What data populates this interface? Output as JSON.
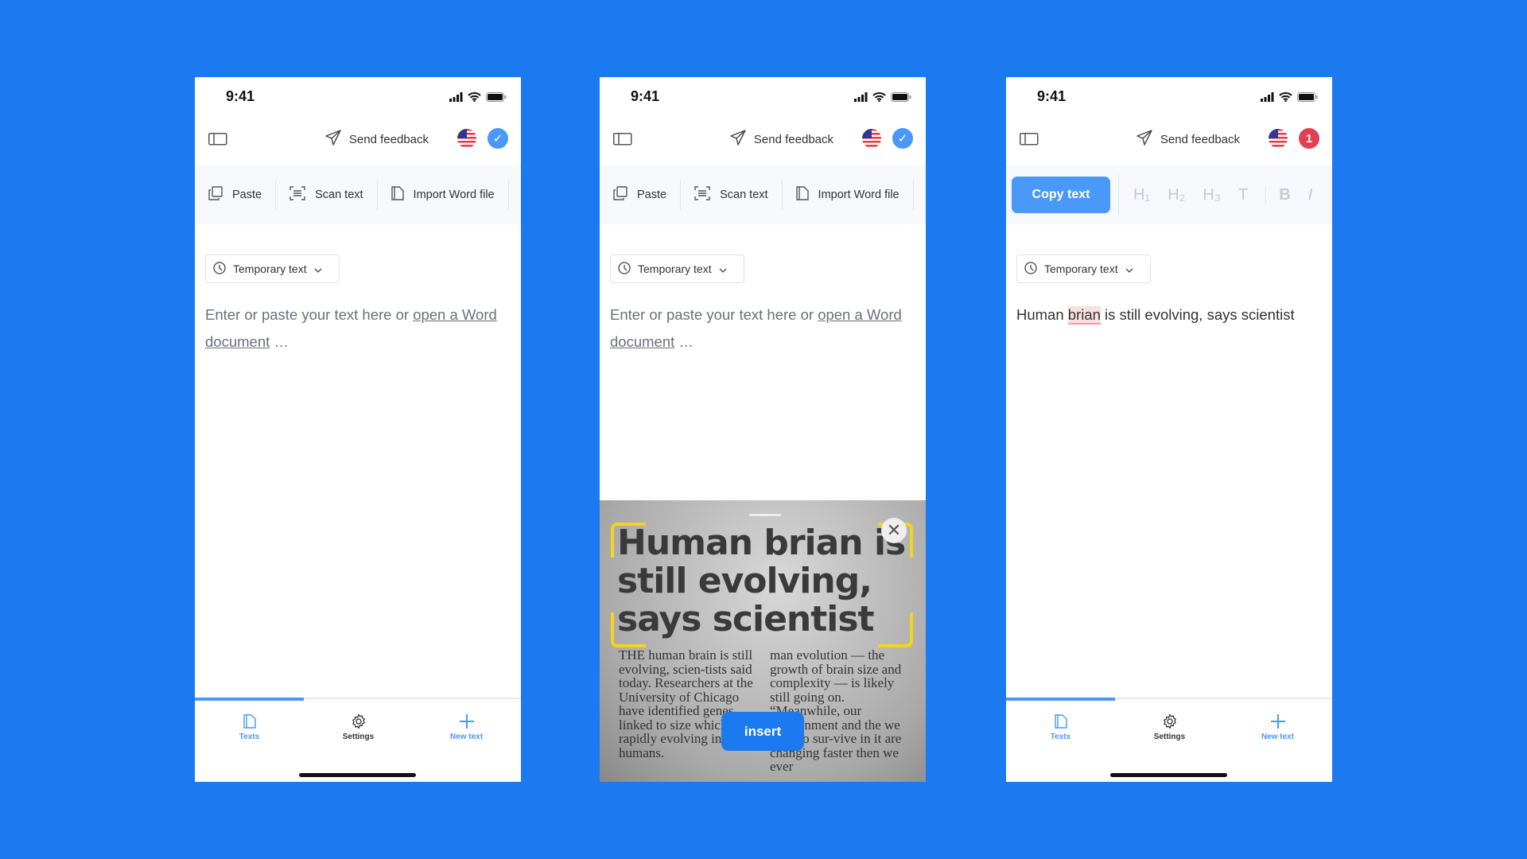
{
  "accent": "#4a98f7",
  "background": "#1b7af0",
  "screens": [
    {
      "status_time": "9:41",
      "send_feedback": "Send feedback",
      "badge": {
        "type": "check",
        "text": "✓",
        "color": "#4a98f7"
      },
      "toolbar": {
        "paste": "Paste",
        "scan": "Scan text",
        "import": "Import Word file"
      },
      "dropdown": "Temporary text",
      "placeholder": {
        "before": "Enter or paste your text here or ",
        "link": "open a Word document",
        "after": " …"
      },
      "nav": {
        "texts": "Texts",
        "settings": "Settings",
        "new_text": "New text"
      }
    },
    {
      "status_time": "9:41",
      "send_feedback": "Send feedback",
      "badge": {
        "type": "check",
        "text": "✓",
        "color": "#4a98f7"
      },
      "toolbar": {
        "paste": "Paste",
        "scan": "Scan text",
        "import": "Import Word file"
      },
      "dropdown": "Temporary text",
      "placeholder": {
        "before": "Enter or paste your text here or ",
        "link": "open a Word document",
        "after": " …"
      },
      "scanner": {
        "headline": [
          "Human brian is",
          "still evolving,",
          "says scientist"
        ],
        "column1": "THE human brain is still evolving, scien-tists said today. Researchers at the University of Chicago have identified genes linked to size which are rapidly evolving in humans.",
        "column2": "man evolution — the growth of brain size and complexity — is likely still going on. “Meanwhile, our environment and the we need to sur-vive in it are changing faster then we ever",
        "insert": "insert"
      }
    },
    {
      "status_time": "9:41",
      "send_feedback": "Send feedback",
      "badge": {
        "type": "count",
        "text": "1",
        "color": "#e0404f"
      },
      "copy_text": "Copy text",
      "format": [
        "H₁",
        "H₂",
        "H₃",
        "T",
        "B",
        "I"
      ],
      "dropdown": "Temporary text",
      "content": {
        "before": "Human ",
        "error": "brian",
        "after": " is still evolving, says scientist"
      },
      "nav": {
        "texts": "Texts",
        "settings": "Settings",
        "new_text": "New text"
      }
    }
  ]
}
